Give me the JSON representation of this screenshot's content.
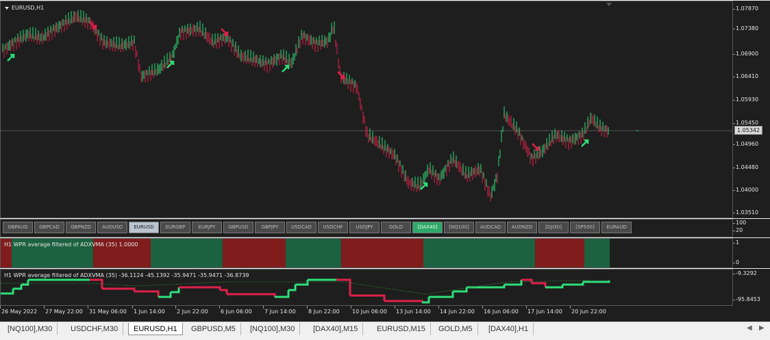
{
  "chart": {
    "symbol_title": "EURUSD,H1",
    "current_price": "1.05342",
    "price_ticks": [
      "1.07870",
      "1.07380",
      "1.06900",
      "1.06410",
      "1.05930",
      "1.05450",
      "1.04960",
      "1.04480",
      "1.04000",
      "1.03510"
    ],
    "colors": {
      "bull": "#2ee07a",
      "bear": "#e0204a",
      "background": "#1e1e1e",
      "grid": "#666666"
    }
  },
  "symbol_buttons": [
    {
      "label": "GBPAUD",
      "state": "normal"
    },
    {
      "label": "GBPCAD",
      "state": "normal"
    },
    {
      "label": "GBPNZD",
      "state": "normal"
    },
    {
      "label": "AUDUSD",
      "state": "normal"
    },
    {
      "label": "EURUSD",
      "state": "active-grey"
    },
    {
      "label": "EURGBP",
      "state": "normal"
    },
    {
      "label": "EURJPY",
      "state": "normal"
    },
    {
      "label": "GBPUSD",
      "state": "normal"
    },
    {
      "label": "GBPJPY",
      "state": "normal"
    },
    {
      "label": "USDCAD",
      "state": "normal"
    },
    {
      "label": "USDCHF",
      "state": "normal"
    },
    {
      "label": "USDJPY",
      "state": "normal"
    },
    {
      "label": "GOLD",
      "state": "normal"
    },
    {
      "label": "[DAX40]",
      "state": "active-green"
    },
    {
      "label": "[NQ100]",
      "state": "normal"
    },
    {
      "label": "AUDCAD",
      "state": "normal"
    },
    {
      "label": "AUDNZD",
      "state": "normal"
    },
    {
      "label": "[DJI30]",
      "state": "normal"
    },
    {
      "label": "[SP500]",
      "state": "normal"
    },
    {
      "label": "EURAUD",
      "state": "normal"
    }
  ],
  "button_axis": [
    "100",
    "20"
  ],
  "indicator1": {
    "label": "H1  WPR average filtered of ADXVMA (35) 1.0000",
    "axis": [
      "1",
      "0"
    ]
  },
  "indicator2": {
    "label": "H1  WPR average filtered of ADXVMA (35) -36.1124 -45.1392 -35.9471 -35.9471 -36.8739",
    "axis": [
      "-9.3292",
      "-95.8453"
    ]
  },
  "time_labels": [
    "26 May 2022",
    "27 May 22:00",
    "31 May 06:00",
    "1 Jun 14:00",
    "2 Jun 22:00",
    "6 Jun 06:00",
    "7 Jun 14:00",
    "8 Jun 22:00",
    "10 Jun 06:00",
    "13 Jun 14:00",
    "14 Jun 22:00",
    "16 Jun 06:00",
    "17 Jun 14:00",
    "20 Jun 22:00"
  ],
  "tabs": [
    "[NQ100],M30",
    "USDCHF,M30",
    "EURUSD,H1",
    "GBPUSD,M5",
    "[NQ100],M30",
    "[DAX40],M15",
    "EURUSD,M15",
    "GOLD,M5",
    "[DAX40],H1"
  ],
  "active_tab": "EURUSD,H1",
  "nav": {
    "left": "◀",
    "right": "▶"
  }
}
